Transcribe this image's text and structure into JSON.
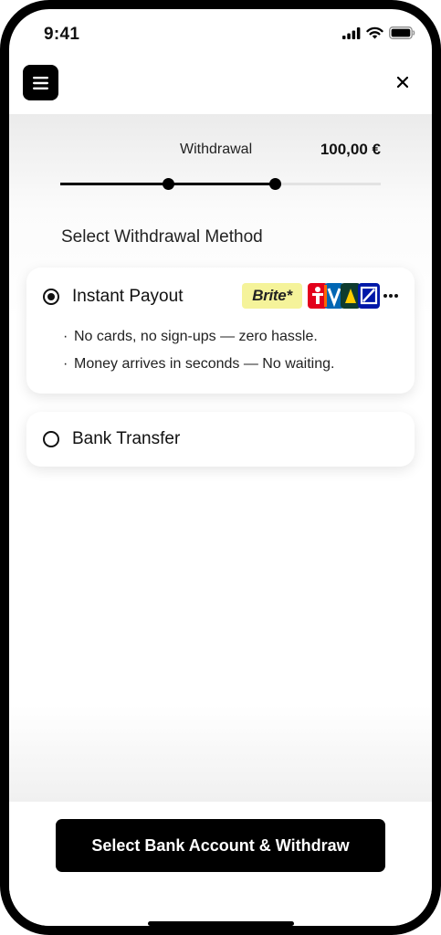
{
  "status_bar": {
    "time": "9:41",
    "icons": [
      "signal-icon",
      "wifi-icon",
      "battery-icon"
    ]
  },
  "header": {
    "menu_icon": "hamburger-menu-icon",
    "close_icon": "close-icon"
  },
  "withdrawal": {
    "label": "Withdrawal",
    "amount": "100,00 €",
    "progress": {
      "steps_total": 3,
      "current_step": 2,
      "fraction": 0.67
    }
  },
  "method_section": {
    "title": "Select Withdrawal Method",
    "options": [
      {
        "label": "Instant Payout",
        "selected": true,
        "bullets": [
          "No cards, no sign-ups — zero hassle.",
          "Money arrives in seconds — No waiting."
        ],
        "provider_logo": "Brite*",
        "bank_logos": [
          "sparkasse-logo",
          "volksbank-logo",
          "commerzbank-logo",
          "deutsche-bank-logo",
          "more-icon"
        ]
      },
      {
        "label": "Bank Transfer",
        "selected": false
      }
    ]
  },
  "cta": {
    "label": "Select Bank Account & Withdraw"
  },
  "colors": {
    "primary": "#000000",
    "background": "#ffffff",
    "brite_bg": "#f5f39a",
    "sparkasse_red": "#e3001b",
    "volksbank_blue": "#0066b3",
    "volksbank_orange": "#ff6600",
    "commerzbank_green": "#0e3b2e",
    "commerzbank_yellow": "#ffcc00",
    "deutsche_bank_blue": "#0018a8"
  }
}
